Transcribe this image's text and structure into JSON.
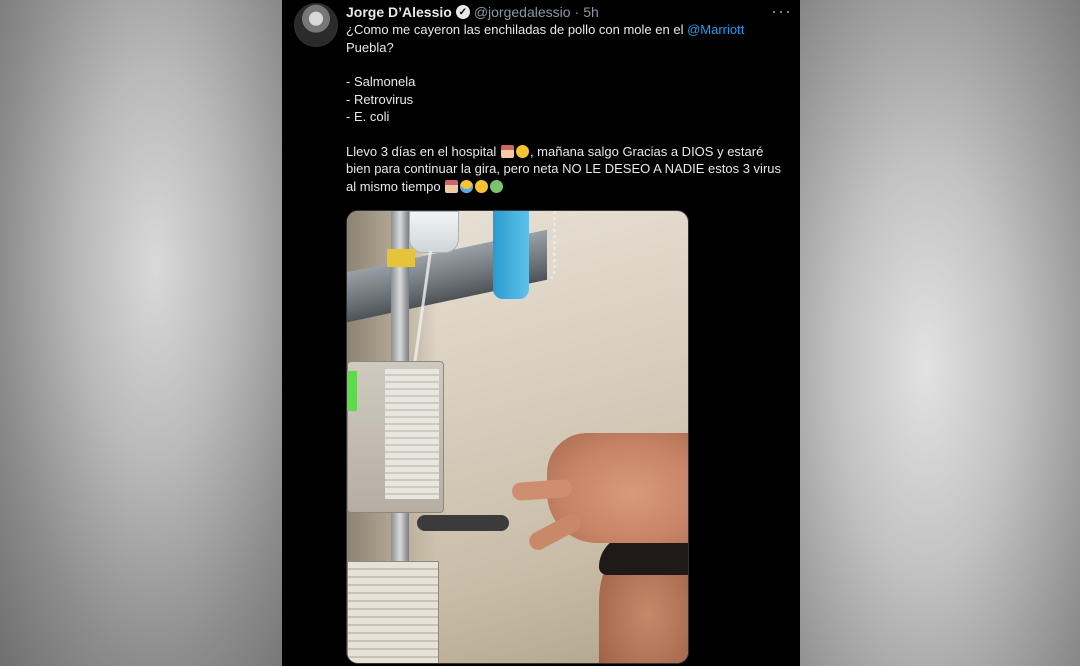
{
  "tweet": {
    "author_name": "Jorge D’Alessio",
    "handle": "@jorgedalessio",
    "separator": "·",
    "time": "5h",
    "more_icon": "···",
    "verified_icon": "✓",
    "text_line1_prefix": "¿Como me cayeron las enchiladas de pollo con mole en el ",
    "mention": "@Marriott",
    "text_line2": "Puebla?",
    "list_items": [
      "- Salmonela",
      "- Retrovirus",
      "- E. coli"
    ],
    "para2_prefix": "Llevo 3 días en el hospital ",
    "para2_middle": ", mañana salgo Gracias a DIOS y estaré",
    "para2_line2": "bien para continuar la gira, pero neta NO LE DESEO A NADIE estos 3 virus",
    "para2_line3": "al mismo tiempo ",
    "emojis_line1": [
      "hospital",
      "tired-face"
    ],
    "emojis_line3": [
      "hospital",
      "crying-face",
      "tired-face",
      "nauseated-face"
    ]
  },
  "media": {
    "description_icons": [
      "iv-pole",
      "iv-bag",
      "face-mask",
      "infusion-pump",
      "hand-peace-sign"
    ]
  },
  "colors": {
    "background": "#000000",
    "text": "#e7e9ea",
    "secondary": "#8b98a5",
    "mention": "#1d9bf0"
  }
}
